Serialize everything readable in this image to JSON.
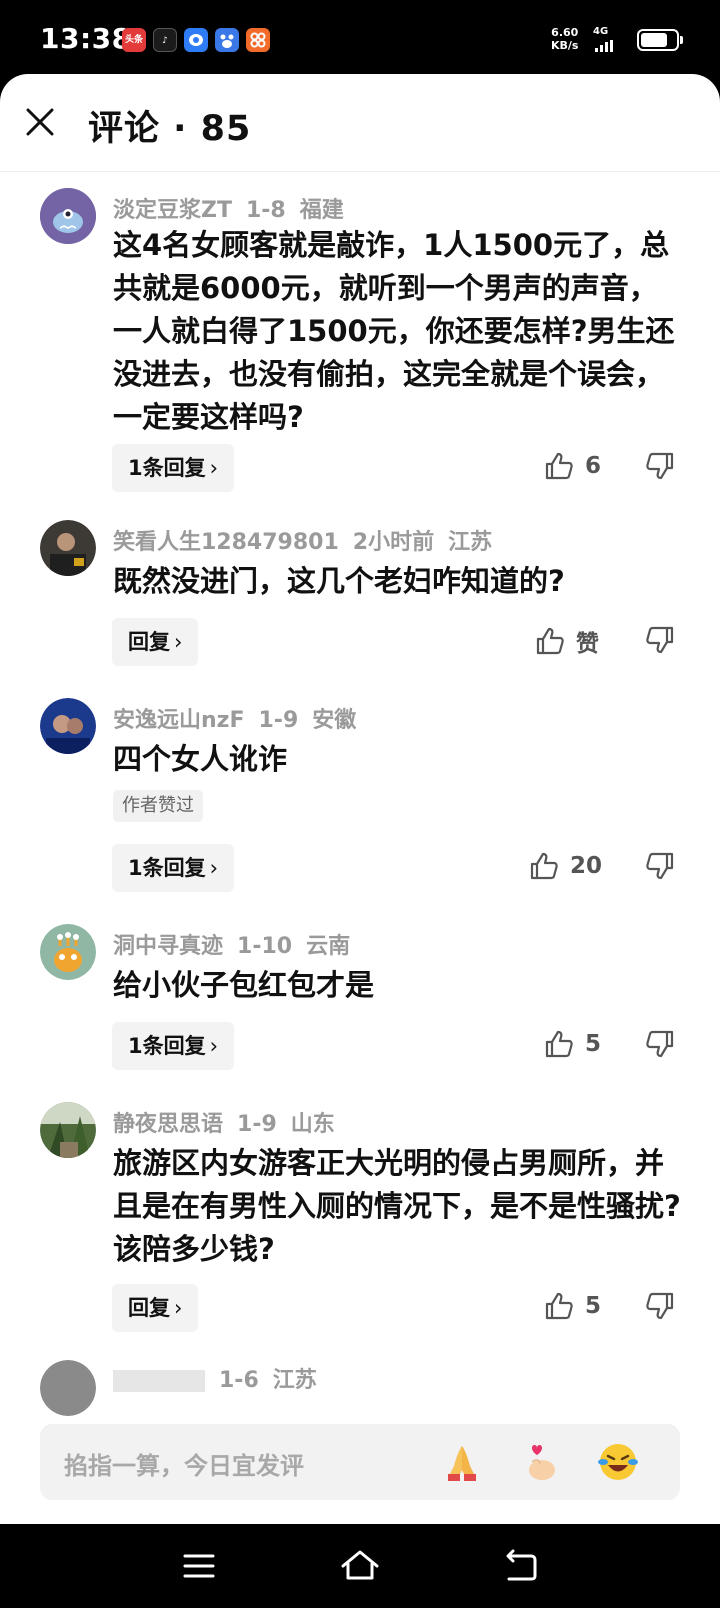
{
  "status_bar": {
    "time": "13:38",
    "app_icons": [
      {
        "name": "toutiao-icon",
        "label": "头条",
        "color": "#e33a3a"
      },
      {
        "name": "douyin-icon",
        "label": "♪",
        "color": "#1b1b1b"
      },
      {
        "name": "bubble-app-icon",
        "label": "",
        "color": "#2e7cf6"
      },
      {
        "name": "baidu-icon",
        "label": "",
        "color": "#3a78e8"
      },
      {
        "name": "store-app-icon",
        "label": "",
        "color": "#f26b2a"
      }
    ],
    "net_speed_value": "6.60",
    "net_speed_unit": "KB/s",
    "network": "4G"
  },
  "header": {
    "title": "评论 · 85"
  },
  "comments": [
    {
      "user": "淡定豆浆ZT",
      "date": "1-8",
      "location": "福建",
      "text": "这4名女顾客就是敲诈，1人1500元了，总共就是6000元，就听到一个男声的声音，一人就白得了1500元，你还要怎样?男生还没进去，也没有偷拍，这完全就是个误会，一定要这样吗?",
      "reply_label": "1条回复",
      "likes": "6"
    },
    {
      "user": "笑看人生128479801",
      "date": "2小时前",
      "location": "江苏",
      "text": "既然没进门，这几个老妇咋知道的?",
      "reply_label": "回复",
      "likes": "赞"
    },
    {
      "user": "安逸远山nzF",
      "date": "1-9",
      "location": "安徽",
      "text": "四个女人讹诈",
      "badge": "作者赞过",
      "reply_label": "1条回复",
      "likes": "20"
    },
    {
      "user": "洞中寻真迹",
      "date": "1-10",
      "location": "云南",
      "text": "给小伙子包红包才是",
      "reply_label": "1条回复",
      "likes": "5"
    },
    {
      "user": "静夜思思语",
      "date": "1-9",
      "location": "山东",
      "text": "旅游区内女游客正大光明的侵占男厕所，并且是在有男性入厕的情况下，是不是性骚扰?该陪多少钱?",
      "reply_label": "回复",
      "likes": "5"
    },
    {
      "user": "",
      "date": "1-6",
      "location": "江苏",
      "text": "",
      "reply_label": "",
      "likes": ""
    }
  ],
  "input": {
    "placeholder": "掐指一算，今日宜发评",
    "emojis": [
      "praying-hands-emoji",
      "heart-hand-emoji",
      "laughing-crying-emoji"
    ]
  },
  "nav": {
    "buttons": [
      "menu-icon",
      "home-icon",
      "back-icon"
    ]
  }
}
